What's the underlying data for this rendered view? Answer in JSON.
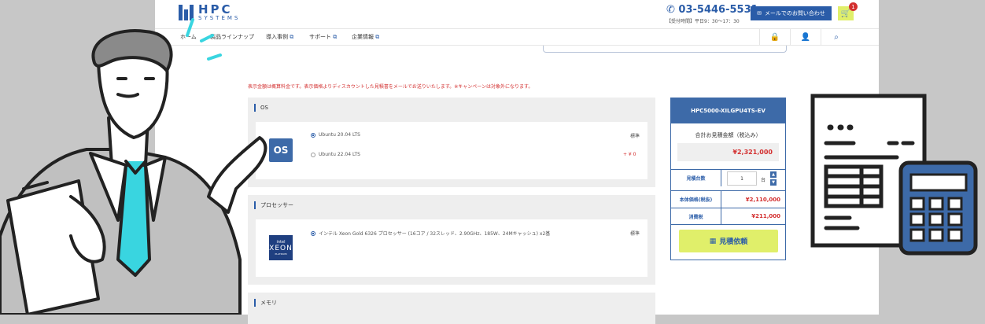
{
  "header": {
    "logo_main": "HPC",
    "logo_sub": "SYSTEMS",
    "phone": "03-5446-5531",
    "hours": "【受付時間】平日9：30〜17：30",
    "mail_button": "メールでのお問い合わせ",
    "cart_count": "1"
  },
  "nav": {
    "items": [
      "ホーム",
      "製品ラインナップ",
      "導入事例",
      "サポート",
      "企業情報"
    ]
  },
  "notice": "表示金額は概算料金です。表示価格よりディスカウントした見積書をメールでお送りいたします。※キャンペーンは対象外になります。",
  "sections": {
    "os": {
      "title": "OS",
      "badge": "OS",
      "options": [
        {
          "label": "Ubuntu 20.04 LTS",
          "selected": true,
          "tag": "標準"
        },
        {
          "label": "Ubuntu 22.04 LTS",
          "selected": false,
          "price": "+ ¥ 0"
        }
      ]
    },
    "processor": {
      "title": "プロセッサー",
      "badge_brand": "intel",
      "badge_name": "XEON",
      "badge_sub": "PLATINUM",
      "options": [
        {
          "label": "インテル Xeon Gold 6326 プロセッサー (16コア / 32スレッド、2.90GHz、185W、24Mキャッシュ) x2基",
          "selected": true,
          "tag": "標準"
        }
      ]
    },
    "memory": {
      "title": "メモリ"
    }
  },
  "panel": {
    "model": "HPC5000-XILGPU4TS-EV",
    "total_label": "合計お見積金額（税込み）",
    "total": "¥2,321,000",
    "qty_label": "見積台数",
    "qty_value": "1",
    "qty_unit": "台",
    "base_label": "本体価格(税抜)",
    "base_value": "¥2,110,000",
    "tax_label": "消費税",
    "tax_value": "¥211,000",
    "quote_button": "見積依頼"
  },
  "colors": {
    "accent": "#2a5ca8",
    "price_red": "#d32f2f",
    "button_yellow": "#e0ef6a",
    "outer_bg": "#c7c7c7"
  }
}
